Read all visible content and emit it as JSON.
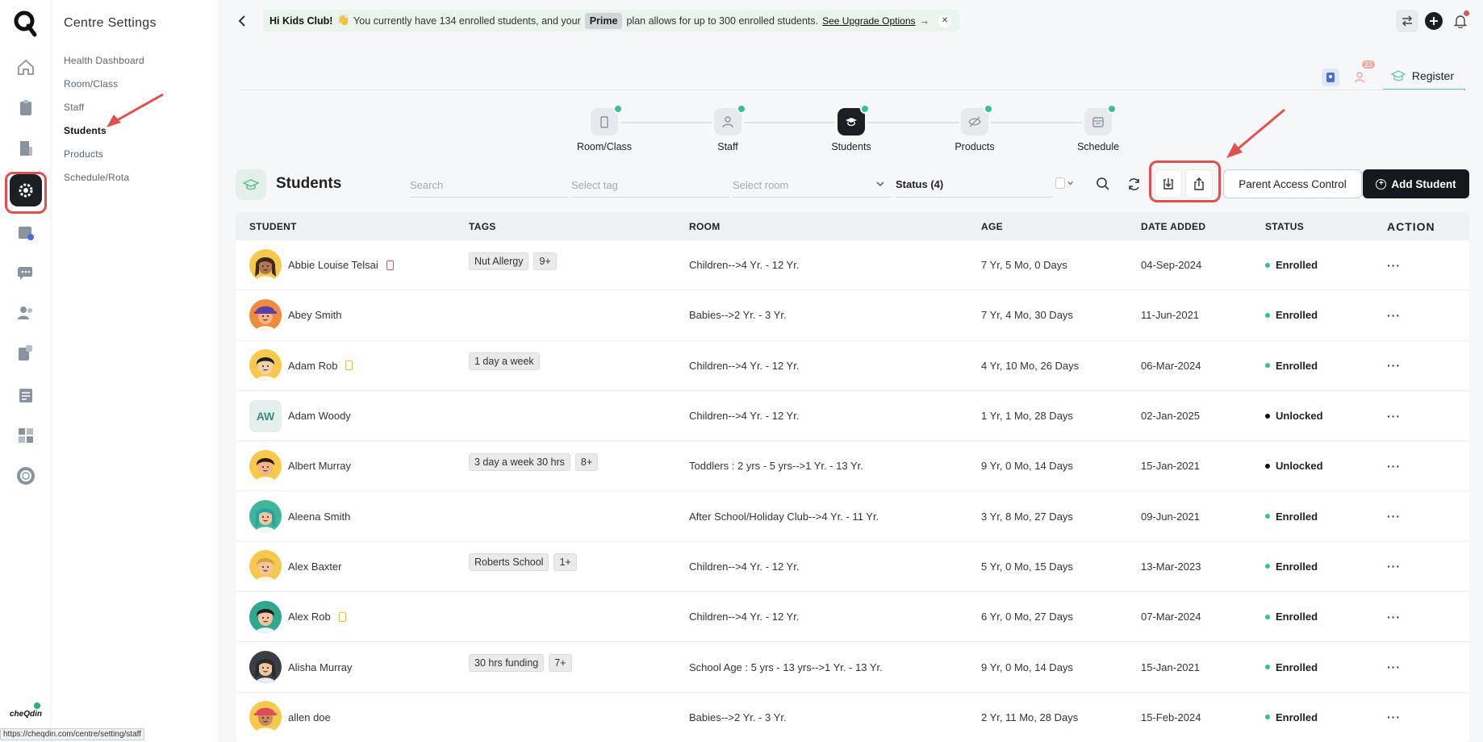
{
  "settings": {
    "title": "Centre Settings",
    "items": [
      {
        "label": "Health Dashboard",
        "active": false
      },
      {
        "label": "Room/Class",
        "active": false
      },
      {
        "label": "Staff",
        "active": false
      },
      {
        "label": "Students",
        "active": true
      },
      {
        "label": "Products",
        "active": false
      },
      {
        "label": "Schedule/Rota",
        "active": false
      }
    ]
  },
  "rail": {
    "brand": "cheQdin",
    "icons": [
      "home-icon",
      "clipboard-icon",
      "building-icon",
      "settings-icon",
      "calendar-check-icon",
      "chat-icon",
      "users-icon",
      "notes-icon",
      "checklist-icon",
      "grid-icon",
      "support-icon"
    ]
  },
  "banner": {
    "greeting": "Hi Kids Club!",
    "emoji": "👋",
    "text_before": "You currently have 134 enrolled students, and your",
    "plan": "Prime",
    "text_after": "plan allows for up to 300 enrolled students.",
    "link": "See Upgrade Options",
    "arrow": "→",
    "close": "✕"
  },
  "subtabs": {
    "badge": "23",
    "register": "Register"
  },
  "stepper": [
    {
      "label": "Room/Class",
      "icon": "door-icon",
      "active": false
    },
    {
      "label": "Staff",
      "icon": "staff-icon",
      "active": false
    },
    {
      "label": "Students",
      "icon": "graduation-cap-icon",
      "active": true
    },
    {
      "label": "Products",
      "icon": "eye-off-icon",
      "active": false
    },
    {
      "label": "Schedule",
      "icon": "schedule-icon",
      "active": false
    }
  ],
  "toolbar": {
    "title": "Students",
    "search_placeholder": "Search",
    "tag_placeholder": "Select tag",
    "room_placeholder": "Select room",
    "status": "Status (4)",
    "parent_access": "Parent Access Control",
    "add_student": "Add Student"
  },
  "table": {
    "columns": [
      "STUDENT",
      "TAGS",
      "ROOM",
      "AGE",
      "DATE ADDED",
      "STATUS",
      "ACTION"
    ],
    "rows": [
      {
        "name": "Abbie Louise Telsai",
        "tags": [
          "Nut Allergy",
          "9+"
        ],
        "room": "Children-->4 Yr. - 12 Yr.",
        "age": "7 Yr, 5 Mo, 0 Days",
        "date": "04-Sep-2024",
        "status": "Enrolled",
        "action": "···",
        "avatar": "girl-braids",
        "skin": "#b07850",
        "hair": "#3b2a20",
        "bg": "#f6c94c",
        "marker": "red"
      },
      {
        "name": "Abey Smith",
        "tags": [],
        "room": "Babies-->2 Yr. - 3 Yr.",
        "age": "7 Yr, 4 Mo, 30 Days",
        "date": "11-Jun-2021",
        "status": "Enrolled",
        "action": "···",
        "avatar": "boy-cap",
        "skin": "#f2b48a",
        "hair": "#5b3ea8",
        "bg": "#f08a3c",
        "marker": ""
      },
      {
        "name": "Adam Rob",
        "tags": [
          "1 day a week"
        ],
        "room": "Children-->4 Yr. - 12 Yr.",
        "age": "4 Yr, 10 Mo, 26 Days",
        "date": "06-Mar-2024",
        "status": "Enrolled",
        "action": "···",
        "avatar": "boy",
        "skin": "#f5d0b0",
        "hair": "#1f1f1f",
        "bg": "#f6c94c",
        "marker": "yellow"
      },
      {
        "name": "Adam Woody",
        "tags": [],
        "room": "Children-->4 Yr. - 12 Yr.",
        "age": "1 Yr, 1 Mo, 28 Days",
        "date": "02-Jan-2025",
        "status": "Unlocked",
        "action": "···",
        "avatar": "initials",
        "initials": "AW",
        "marker": ""
      },
      {
        "name": "Albert Murray",
        "tags": [
          "3 day a week 30 hrs",
          "8+"
        ],
        "room": "Toddlers : 2 yrs - 5 yrs-->1 Yr. - 13 Yr.",
        "age": "9 Yr, 0 Mo, 14 Days",
        "date": "15-Jan-2021",
        "status": "Unlocked",
        "action": "···",
        "avatar": "boy",
        "skin": "#f2b48a",
        "hair": "#2a1c15",
        "bg": "#f6c94c",
        "marker": ""
      },
      {
        "name": "Aleena Smith",
        "tags": [],
        "room": "After School/Holiday Club-->4 Yr. - 11 Yr.",
        "age": "3 Yr, 8 Mo, 27 Days",
        "date": "09-Jun-2021",
        "status": "Enrolled",
        "action": "···",
        "avatar": "girl",
        "skin": "#f2c4a0",
        "hair": "#2aa3a3",
        "bg": "#3fb59a",
        "marker": ""
      },
      {
        "name": "Alex Baxter",
        "tags": [
          "Roberts School",
          "1+"
        ],
        "room": "Children-->4 Yr. - 12 Yr.",
        "age": "5 Yr, 0 Mo, 15 Days",
        "date": "13-Mar-2023",
        "status": "Enrolled",
        "action": "···",
        "avatar": "boy",
        "skin": "#f2c4a0",
        "hair": "#d9a032",
        "bg": "#f6c94c",
        "marker": ""
      },
      {
        "name": "Alex Rob",
        "tags": [],
        "room": "Children-->4 Yr. - 12 Yr.",
        "age": "6 Yr, 0 Mo, 27 Days",
        "date": "07-Mar-2024",
        "status": "Enrolled",
        "action": "···",
        "avatar": "boy",
        "skin": "#f2c4a0",
        "hair": "#1f1f1f",
        "bg": "#2fa88e",
        "marker": "yellow"
      },
      {
        "name": "Alisha Murray",
        "tags": [
          "30 hrs funding",
          "7+"
        ],
        "room": "School Age : 5 yrs - 13 yrs-->1 Yr. - 13 Yr.",
        "age": "9 Yr, 0 Mo, 14 Days",
        "date": "15-Jan-2021",
        "status": "Enrolled",
        "action": "···",
        "avatar": "girl",
        "skin": "#f2c4a0",
        "hair": "#2b2b2b",
        "bg": "#3a3f45",
        "marker": ""
      },
      {
        "name": "allen doe",
        "tags": [],
        "room": "Babies-->2 Yr. - 3 Yr.",
        "age": "2 Yr, 11 Mo, 28 Days",
        "date": "15-Feb-2024",
        "status": "Enrolled",
        "action": "···",
        "avatar": "boy-cap",
        "skin": "#c98b5c",
        "hair": "#e04a5a",
        "bg": "#f6c94c",
        "marker": ""
      }
    ]
  },
  "colors": {
    "accent": "#34c38f",
    "enrolled": "#34c38f",
    "unlocked": "#111111",
    "annotation": "#e05050"
  },
  "status_bar_url": "https://cheqdin.com/centre/setting/staff"
}
